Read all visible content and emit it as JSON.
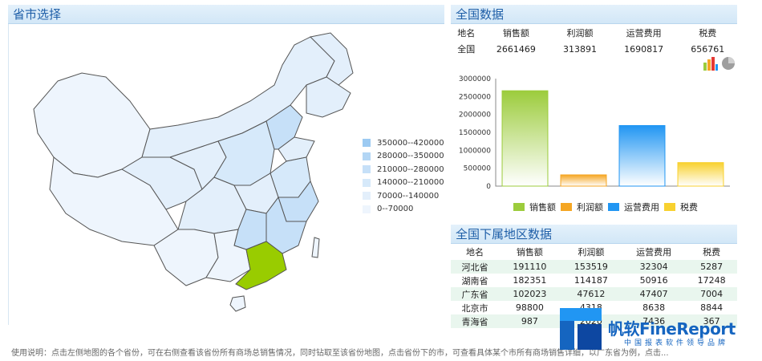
{
  "left_panel": {
    "title": "省市选择"
  },
  "map_legend": {
    "items": [
      {
        "label": "350000--420000",
        "color": "#9ccaf2"
      },
      {
        "label": "280000--350000",
        "color": "#b3d6f5"
      },
      {
        "label": "210000--280000",
        "color": "#c6e0f8"
      },
      {
        "label": "140000--210000",
        "color": "#d6e9fa"
      },
      {
        "label": "70000--140000",
        "color": "#e3effb"
      },
      {
        "label": "0--70000",
        "color": "#eef5fd"
      }
    ]
  },
  "summary": {
    "title": "全国数据",
    "headers": [
      "地名",
      "销售额",
      "利润额",
      "运营费用",
      "税费"
    ],
    "row": [
      "全国",
      "2661469",
      "313891",
      "1690817",
      "656761"
    ]
  },
  "chart_data": {
    "type": "bar",
    "categories": [
      "销售额",
      "利润额",
      "运营费用",
      "税费"
    ],
    "values": [
      2661469,
      313891,
      1690817,
      656761
    ],
    "colors": [
      "#9ccc3c",
      "#f5a623",
      "#2196f3",
      "#f8d12f"
    ],
    "ylim": [
      0,
      3000000
    ],
    "yticks": [
      "0",
      "500000",
      "1000000",
      "1500000",
      "2000000",
      "2500000",
      "3000000"
    ],
    "legend_position": "bottom"
  },
  "regions": {
    "title": "全国下属地区数据",
    "headers": [
      "地名",
      "销售额",
      "利润额",
      "运营费用",
      "税费"
    ],
    "rows": [
      [
        "河北省",
        "191110",
        "153519",
        "32304",
        "5287"
      ],
      [
        "湖南省",
        "182351",
        "114187",
        "50916",
        "17248"
      ],
      [
        "广东省",
        "102023",
        "47612",
        "47407",
        "7004"
      ],
      [
        "北京市",
        "98800",
        "4318",
        "8638",
        "8844"
      ],
      [
        "青海省",
        "987",
        "2020",
        "7436",
        "367"
      ]
    ]
  },
  "footer": {
    "note": "使用说明：点击左侧地图的各个省份，可在右侧查看该省份所有商场总销售情况，同时钻取至该省份地图，点击省份下的市，可查看具体某个市所有商场销售详细，以广东省为例，点击..."
  },
  "watermark": {
    "brand": "帆软FineReport",
    "slogan": "中国报表软件领导品牌"
  }
}
